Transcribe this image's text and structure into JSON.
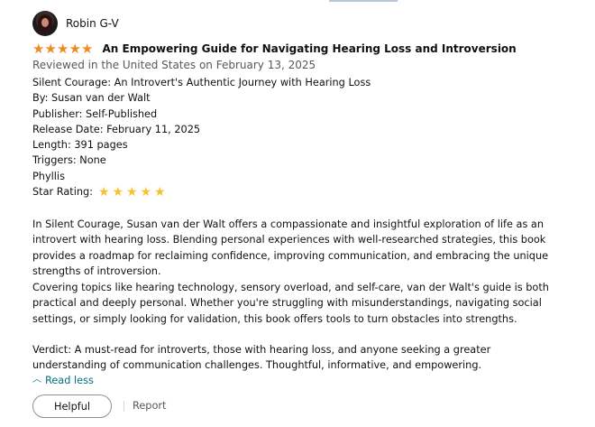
{
  "reviewer": {
    "name": "Robin G-V",
    "avatar_icon": "avatar-photo"
  },
  "review": {
    "rating_stars": 5,
    "title": "An Empowering Guide for Navigating Hearing Loss and Introversion",
    "meta": "Reviewed in the United States on February 13, 2025",
    "details": {
      "book_title": "Silent Courage: An Introvert's Authentic Journey with Hearing Loss",
      "author": "By: Susan van der Walt",
      "publisher": "Publisher: Self-Published",
      "release": "Release Date: February 11, 2025",
      "length": "Length: 391 pages",
      "triggers": "Triggers: None",
      "signature": "Phyllis",
      "star_label": "Star Rating:",
      "star_rating_count": 5
    },
    "paragraphs": {
      "p1": "In Silent Courage, Susan van der Walt offers a compassionate and insightful exploration of life as an introvert with hearing loss. Blending personal experiences with well-researched strategies, this book provides a roadmap for reclaiming confidence, improving communication, and embracing the unique strengths of introversion.",
      "p2": "Covering topics like hearing technology, sensory overload, and self-care, van der Walt's guide is both practical and deeply personal. Whether you're struggling with misunderstandings, navigating social settings, or simply looking for validation, this book offers tools to turn obstacles into strengths.",
      "p3": "Verdict: A must-read for introverts, those with hearing loss, and anyone seeking a greater understanding of communication challenges. Thoughtful, informative, and empowering."
    }
  },
  "actions": {
    "read_less": "Read less",
    "helpful": "Helpful",
    "report": "Report"
  },
  "colors": {
    "title_star": "#f08a24",
    "rating_star": "#f4c430",
    "link": "#007185",
    "muted": "#565959"
  }
}
